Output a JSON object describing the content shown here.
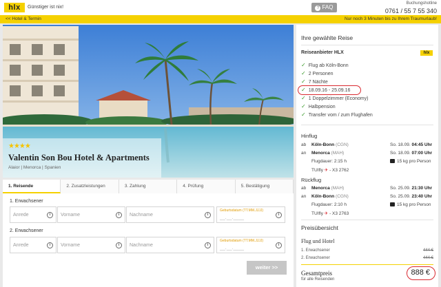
{
  "header": {
    "logo": "hlx",
    "slogan": "Günstiger ist nix!",
    "faq": "FAQ",
    "hotline_label": "Buchungshotline",
    "hotline_number": "0761 / 55 7 55 340"
  },
  "bar": {
    "back": "<< Hotel & Termin",
    "promo": "Nur noch 3 Minuten bis zu Ihrem Traumurlaub!"
  },
  "hotel": {
    "stars": "★★★★",
    "name": "Valentin Son Bou Hotel & Apartments",
    "location": "Alaior | Menorca | Spanien"
  },
  "steps": [
    "1. Reisende",
    "2. Zusatzleistungen",
    "3. Zahlung",
    "4. Prüfung",
    "5. Bestätigung"
  ],
  "form": {
    "persons": [
      {
        "label": "1. Erwachsener"
      },
      {
        "label": "2. Erwachsener"
      }
    ],
    "salutation_placeholder": "Anrede",
    "firstname_placeholder": "Vorname",
    "lastname_placeholder": "Nachname",
    "birthdate_label": "Geburtsdatum (TT.MM.JJJJ)",
    "birthdate_placeholder": "__.__.____",
    "next_button": "weiter >>"
  },
  "sidebar": {
    "title": "Ihre gewählte Reise",
    "provider_label": "Reiseanbieter HLX",
    "provider_logo": "hlx",
    "features": [
      "Flug ab Köln-Bonn",
      "2 Personen",
      "7 Nächte",
      "18.09.16 - 25.09.16",
      "1 Doppelzimmer (Economy)",
      "Halbpension",
      "Transfer vom / zum Flughafen"
    ],
    "outbound": {
      "title": "Hinflug",
      "dep_prefix": "ab",
      "dep_airport": "Köln-Bonn",
      "dep_code": "(CGN)",
      "dep_date": "So. 18.09.",
      "dep_time": "04:45 Uhr",
      "arr_prefix": "an",
      "arr_airport": "Menorca",
      "arr_code": "(MAH)",
      "arr_date": "So. 18.09.",
      "arr_time": "07:00 Uhr",
      "duration": "Flugdauer: 2:15 h",
      "baggage": "15 kg pro Person",
      "carrier": "TUIfly",
      "flight": "- X3 2762"
    },
    "inbound": {
      "title": "Rückflug",
      "dep_prefix": "ab",
      "dep_airport": "Menorca",
      "dep_code": "(MAH)",
      "dep_date": "So. 25.09.",
      "dep_time": "21:30 Uhr",
      "arr_prefix": "an",
      "arr_airport": "Köln-Bonn",
      "arr_code": "(CGN)",
      "arr_date": "So. 25.09.",
      "arr_time": "23:40 Uhr",
      "duration": "Flugdauer: 2:10 h",
      "baggage": "15 kg pro Person",
      "carrier": "TUIfly",
      "flight": "- X3 2763"
    },
    "price_title": "Preisübersicht",
    "price_subtitle": "Flug und Hotel",
    "prices": [
      {
        "label": "1. Erwachsener",
        "value": "444 €"
      },
      {
        "label": "2. Erwachsener",
        "value": "444 €"
      }
    ],
    "total_label": "Gesamtpreis",
    "total_sub": "für alle Reisenden",
    "total_value": "888 €"
  },
  "colors": {
    "accent": "#f5d100",
    "check": "#3a9a2a",
    "highlight": "#d9272e"
  }
}
